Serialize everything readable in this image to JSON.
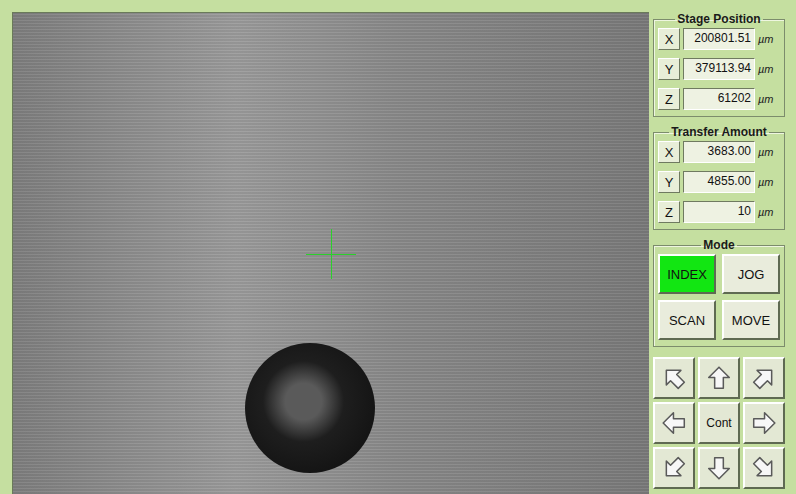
{
  "stage_position": {
    "title": "Stage Position",
    "axes": [
      {
        "label": "X",
        "value": "200801.51",
        "unit": "µm"
      },
      {
        "label": "Y",
        "value": "379113.94",
        "unit": "µm"
      },
      {
        "label": "Z",
        "value": "61202",
        "unit": "µm"
      }
    ]
  },
  "transfer_amount": {
    "title": "Transfer Amount",
    "axes": [
      {
        "label": "X",
        "value": "3683.00",
        "unit": "µm"
      },
      {
        "label": "Y",
        "value": "4855.00",
        "unit": "µm"
      },
      {
        "label": "Z",
        "value": "10",
        "unit": "µm"
      }
    ]
  },
  "mode": {
    "title": "Mode",
    "buttons": [
      {
        "label": "INDEX",
        "selected": true
      },
      {
        "label": "JOG",
        "selected": false
      },
      {
        "label": "SCAN",
        "selected": false
      },
      {
        "label": "MOVE",
        "selected": false
      }
    ]
  },
  "jog_pad": {
    "center_label": "Cont"
  }
}
